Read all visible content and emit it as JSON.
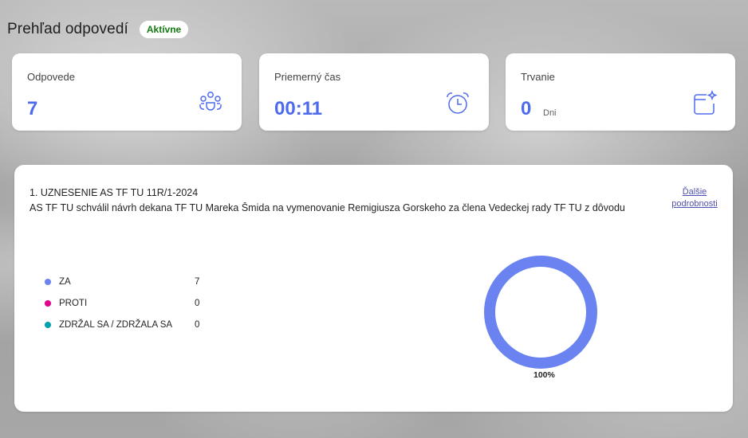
{
  "header": {
    "title": "Prehľad odpovedí",
    "status": "Aktívne"
  },
  "stats": [
    {
      "label": "Odpovede",
      "value": "7",
      "unit": "",
      "icon": "people-group-icon"
    },
    {
      "label": "Priemerný čas",
      "value": "00:11",
      "unit": "",
      "icon": "alarm-clock-icon"
    },
    {
      "label": "Trvanie",
      "value": "0",
      "unit": "Dni",
      "icon": "calendar-sparkle-icon"
    }
  ],
  "question": {
    "title": "1. UZNESENIE AS TF TU 11R/1-2024",
    "text": "AS TF TU schválil návrh dekana TF TU Mareka Šmida na vymenovanie Remigiusza Gorskeho za člena Vedeckej rady TF TU z dôvodu",
    "details_line1": "Ďalšie",
    "details_line2": "podrobnosti"
  },
  "colors": {
    "accent": "#4f6bed",
    "za": "#6b83f0",
    "proti": "#e3008c",
    "zdrzal": "#00a2ad",
    "badge": "#107c10"
  },
  "chart_data": {
    "type": "pie",
    "categories": [
      "ZA",
      "PROTI",
      "ZDRŽAL SA / ZDRŽALA SA"
    ],
    "values": [
      7,
      0,
      0
    ],
    "percent_label": "100%",
    "legend_position": "left"
  }
}
